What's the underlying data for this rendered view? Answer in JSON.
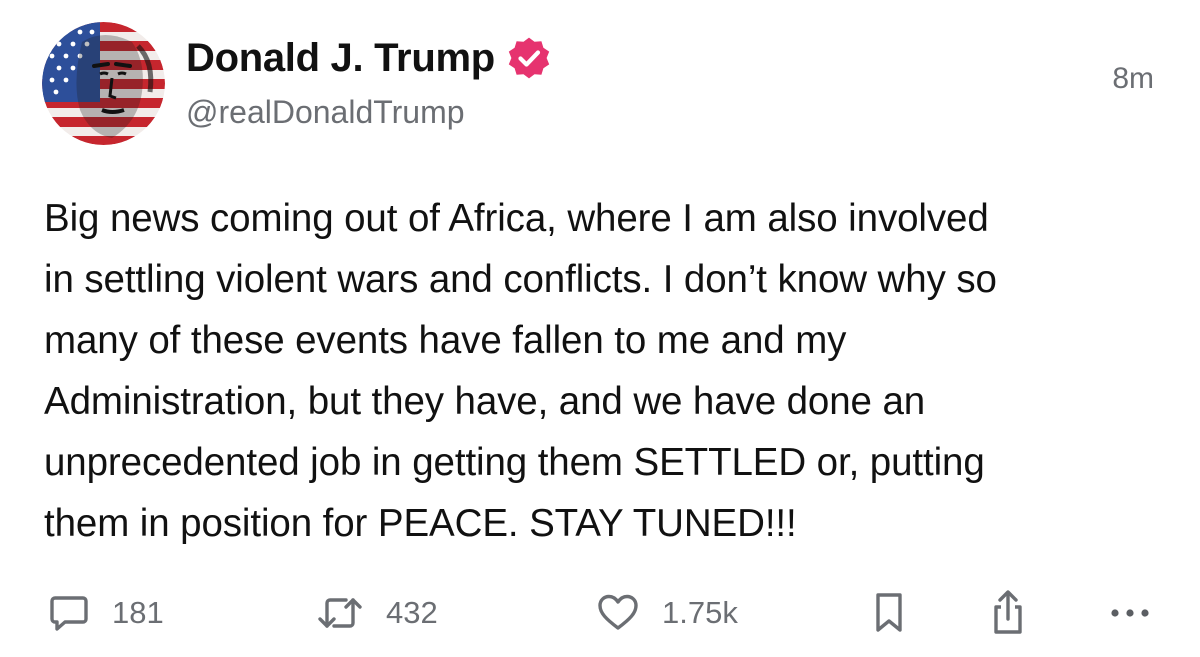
{
  "post": {
    "author": {
      "display_name": "Donald J. Trump",
      "handle": "@realDonaldTrump",
      "verified": true,
      "verified_color": "#e6336f"
    },
    "timestamp": "8m",
    "body_lines": [
      "Big news coming out of Africa, where I am also involved",
      "in settling violent wars and conflicts. I don’t know why so",
      "many of these events have fallen to me and my",
      "Administration, but they have, and we have done an",
      "unprecedented job in getting them SETTLED or, putting",
      "them in position for PEACE. STAY TUNED!!!"
    ],
    "actions": {
      "replies": "181",
      "retruths": "432",
      "likes": "1.75k"
    }
  },
  "icons": {
    "reply": "speech-bubble-icon",
    "retruth": "repost-arrows-icon",
    "like": "heart-icon",
    "bookmark": "bookmark-icon",
    "share": "share-icon",
    "more": "more-dots-icon",
    "verified": "verified-badge-icon"
  },
  "colors": {
    "text": "#111111",
    "muted": "#6b6e73",
    "background": "#ffffff"
  }
}
